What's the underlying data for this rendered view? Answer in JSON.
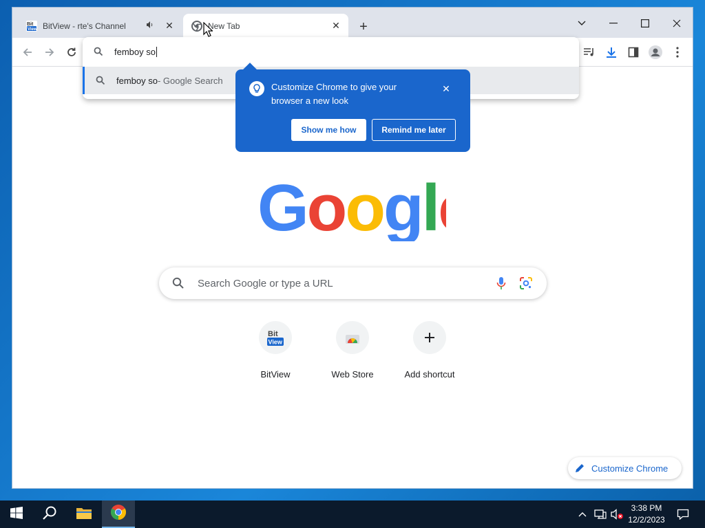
{
  "tabs": [
    {
      "title": "BitView - rte's Channel",
      "favicon": "bitview-icon",
      "audio": true,
      "active": false
    },
    {
      "title": "New Tab",
      "favicon": "chrome-icon",
      "active": true
    }
  ],
  "omnibox": {
    "value": "femboy so",
    "suggestion": {
      "query": "femboy so",
      "suffix": " - Google Search"
    }
  },
  "promo": {
    "text": "Customize Chrome to give your browser a new look",
    "primary_label": "Show me how",
    "secondary_label": "Remind me later"
  },
  "ntp": {
    "logo": "Google",
    "search_placeholder": "Search Google or type a URL",
    "shortcuts": [
      {
        "label": "BitView",
        "icon": "bitview-icon"
      },
      {
        "label": "Web Store",
        "icon": "webstore-icon"
      },
      {
        "label": "Add shortcut",
        "icon": "plus-icon"
      }
    ],
    "customize_label": "Customize Chrome"
  },
  "taskbar": {
    "time": "3:38 PM",
    "date": "12/2/2023"
  },
  "colors": {
    "accent": "#1a73e8",
    "promo_bg": "#1a66cc",
    "google_blue": "#4285f4",
    "google_red": "#ea4335",
    "google_yellow": "#fbbc05",
    "google_green": "#34a853"
  }
}
